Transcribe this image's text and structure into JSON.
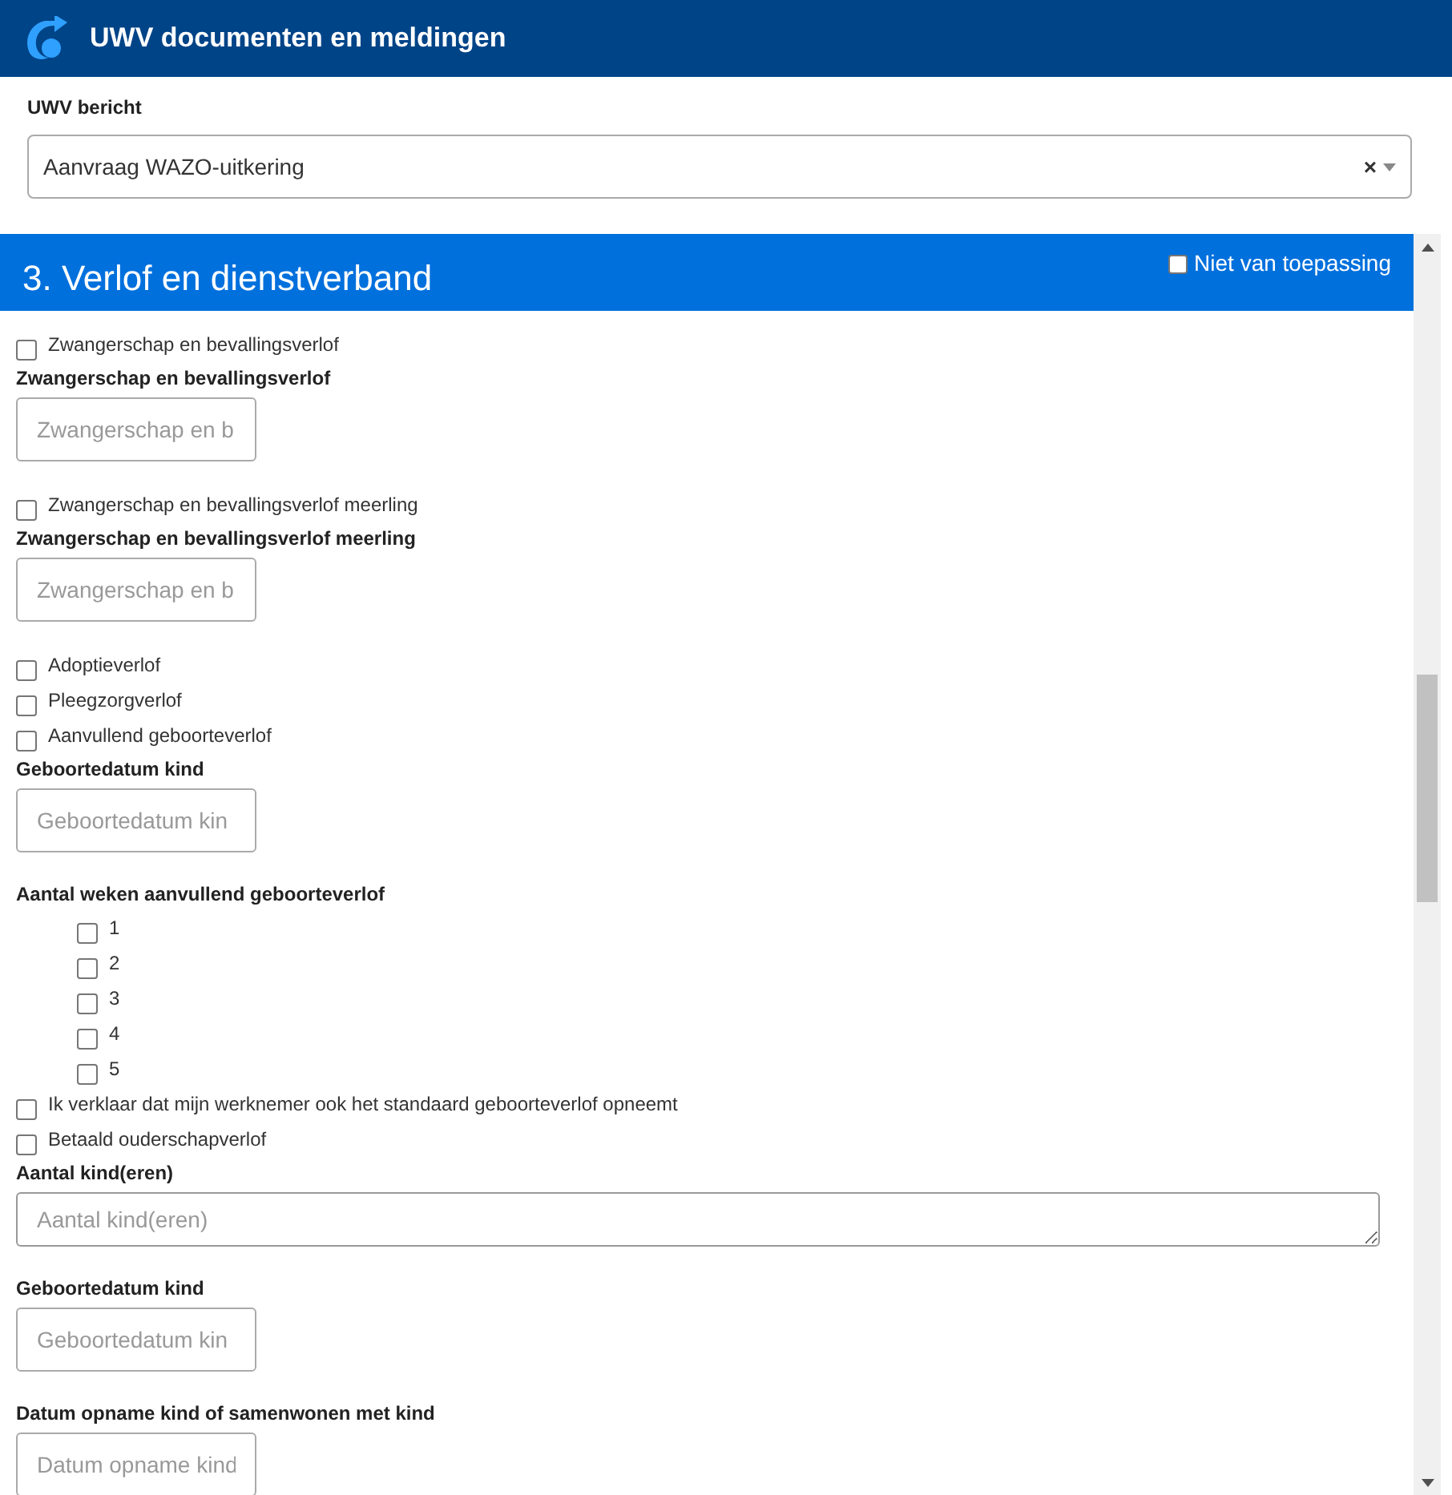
{
  "header": {
    "title": "UWV documenten en meldingen"
  },
  "message_select": {
    "label": "UWV bericht",
    "value": "Aanvraag WAZO-uitkering",
    "clear": "×"
  },
  "section": {
    "title": "3. Verlof en dienstverband",
    "not_applicable": {
      "label": "Niet van toepassing",
      "checked": false
    }
  },
  "items": [
    {
      "kind": "checkbox",
      "label": "Zwangerschap en bevallingsverlof",
      "checked": false
    },
    {
      "kind": "label",
      "label": "Zwangerschap en bevallingsverlof"
    },
    {
      "kind": "input",
      "placeholder": "Zwangerschap en b"
    },
    {
      "kind": "checkbox",
      "label": "Zwangerschap en bevallingsverlof meerling",
      "checked": false
    },
    {
      "kind": "label",
      "label": "Zwangerschap en bevallingsverlof meerling"
    },
    {
      "kind": "input",
      "placeholder": "Zwangerschap en b"
    },
    {
      "kind": "checkbox",
      "label": "Adoptieverlof",
      "checked": false
    },
    {
      "kind": "checkbox",
      "label": "Pleegzorgverlof",
      "checked": false
    },
    {
      "kind": "checkbox",
      "label": "Aanvullend geboorteverlof",
      "checked": false
    },
    {
      "kind": "label",
      "label": "Geboortedatum kind"
    },
    {
      "kind": "input",
      "placeholder": "Geboortedatum kin"
    },
    {
      "kind": "label",
      "label": "Aantal weken aanvullend geboorteverlof"
    },
    {
      "kind": "option",
      "label": "1",
      "checked": false
    },
    {
      "kind": "option",
      "label": "2",
      "checked": false
    },
    {
      "kind": "option",
      "label": "3",
      "checked": false
    },
    {
      "kind": "option",
      "label": "4",
      "checked": false
    },
    {
      "kind": "option",
      "label": "5",
      "checked": false
    },
    {
      "kind": "checkbox",
      "label": "Ik verklaar dat mijn werknemer ook het standaard geboorteverlof opneemt",
      "checked": false
    },
    {
      "kind": "checkbox",
      "label": "Betaald ouderschapverlof",
      "checked": false
    },
    {
      "kind": "label",
      "label": "Aantal kind(eren)"
    },
    {
      "kind": "textarea",
      "placeholder": "Aantal kind(eren)"
    },
    {
      "kind": "label",
      "label": "Geboortedatum kind"
    },
    {
      "kind": "input",
      "placeholder": "Geboortedatum kin"
    },
    {
      "kind": "label",
      "label": "Datum opname kind of samenwonen met kind"
    },
    {
      "kind": "input",
      "placeholder": "Datum opname kind"
    }
  ]
}
